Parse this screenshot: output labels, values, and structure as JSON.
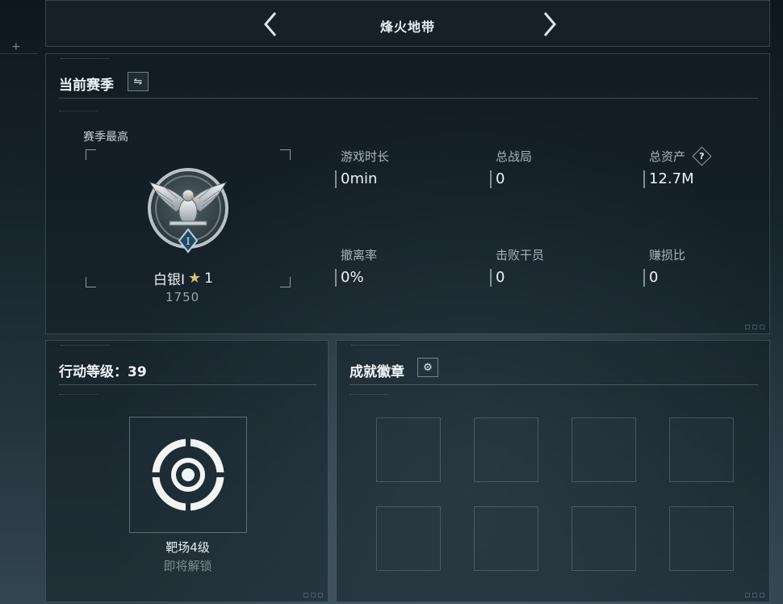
{
  "header": {
    "title": "烽火地带",
    "prev_icon": "chevron-left-icon",
    "next_icon": "chevron-right-icon"
  },
  "season": {
    "title": "当前赛季",
    "switch_icon": "swap-arrows-icon",
    "best_label": "赛季最高",
    "rank": {
      "name": "白银I",
      "stars": "1",
      "score": "1750",
      "emblem_icon": "silver-eagle-emblem-icon",
      "emblem_tier": "I"
    },
    "stats": [
      {
        "label": "游戏时长",
        "value": "0min"
      },
      {
        "label": "总战局",
        "value": "0"
      },
      {
        "label": "总资产",
        "value": "12.7M",
        "help": "?"
      },
      {
        "label": "撤离率",
        "value": "0%"
      },
      {
        "label": "击败干员",
        "value": "0"
      },
      {
        "label": "赚损比",
        "value": "0"
      }
    ]
  },
  "action_level": {
    "label": "行动等级：",
    "level": "39",
    "unlock": {
      "name": "靶场4级",
      "status": "即将解锁",
      "icon": "target-icon"
    }
  },
  "achievements": {
    "title": "成就徽章",
    "settings_icon": "gear-icon",
    "slot_count": 8
  },
  "colors": {
    "background": "#1a2830",
    "panel_border": "#8ca5b0",
    "star": "#d7c27a",
    "muted": "#7f8c92"
  }
}
